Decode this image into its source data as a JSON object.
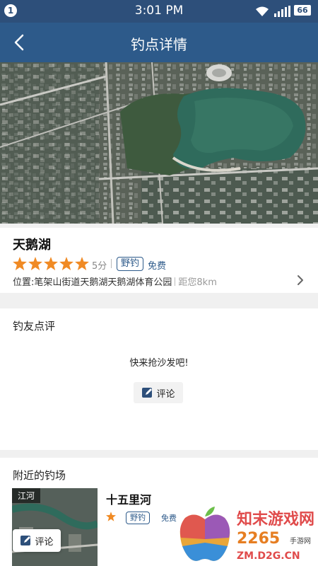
{
  "status_bar": {
    "notification_count": "1",
    "time": "3:01 PM",
    "battery": "66",
    "icons": [
      "wifi-icon",
      "signal-icon",
      "battery-icon"
    ]
  },
  "nav": {
    "title": "钓点详情",
    "back_icon": "chevron-left-icon"
  },
  "spot": {
    "name": "天鹅湖",
    "rating_stars": 5,
    "score": "5分",
    "tag": "野钓",
    "fee": "免费",
    "location_label": "位置:",
    "location": "笔架山街道天鹅湖天鹅湖体育公园",
    "distance": "距您8km"
  },
  "reviews": {
    "title": "钓友点评",
    "empty_message": "快来抢沙发吧!",
    "comment_button": "评论"
  },
  "nearby": {
    "title": "附近的钓场",
    "items": [
      {
        "name": "十五里河",
        "thumb_label": "江河",
        "tag": "野钓",
        "fee": "免费"
      }
    ]
  },
  "floating_comment": {
    "label": "评论"
  },
  "watermark": {
    "line1": "知末游戏网",
    "line2": "2265",
    "line2_suffix": "手游网",
    "url": "ZM.D2G.CN"
  },
  "colors": {
    "status_bar": "#2d4f7a",
    "nav_bar": "#2d5a8a",
    "star": "#f08a24",
    "accent": "#2d5a8a"
  }
}
